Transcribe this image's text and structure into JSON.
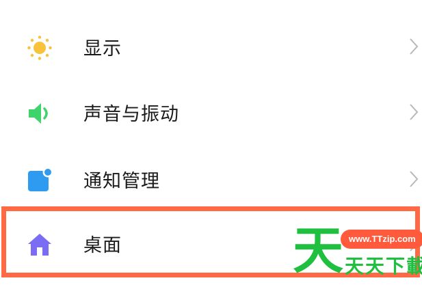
{
  "settings": {
    "items": [
      {
        "label": "显示",
        "icon": "sun-icon",
        "icon_color": "#f8c23a"
      },
      {
        "label": "声音与振动",
        "icon": "speaker-icon",
        "icon_color": "#3ed36b"
      },
      {
        "label": "通知管理",
        "icon": "notification-icon",
        "icon_color": "#2e9bf0"
      },
      {
        "label": "桌面",
        "icon": "home-icon",
        "icon_color": "#7a6cf3"
      }
    ],
    "highlighted_item": "桌面",
    "highlight_color": "#ff6a45"
  },
  "watermark": {
    "logo_char": "天",
    "url": "www.TTzip.com",
    "name": "天天下載",
    "logo_color": "#1fbf3f",
    "url_bg_color": "#ff5a3c"
  }
}
